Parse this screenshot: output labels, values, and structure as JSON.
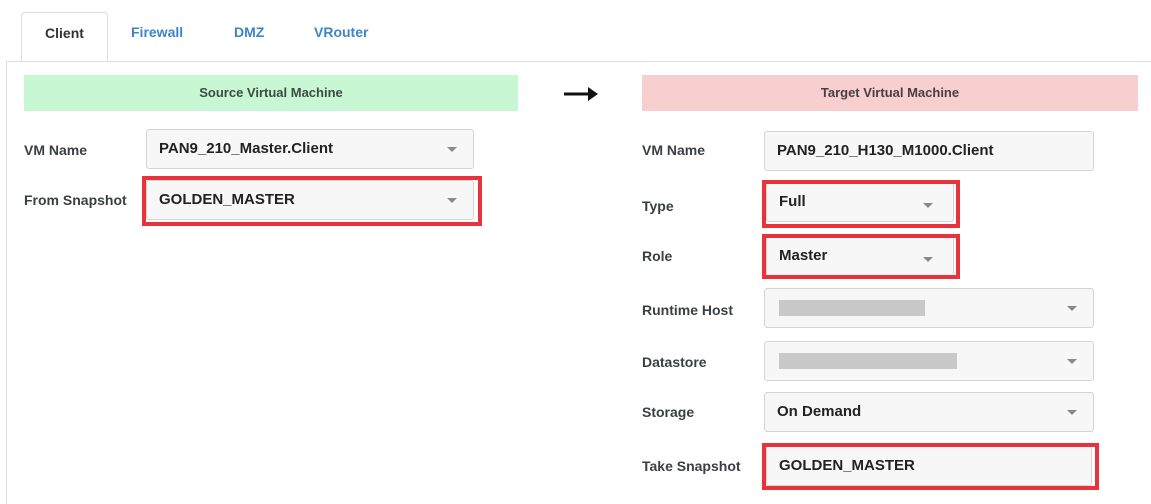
{
  "tabs": [
    {
      "label": "Client",
      "active": true
    },
    {
      "label": "Firewall",
      "active": false
    },
    {
      "label": "DMZ",
      "active": false
    },
    {
      "label": "VRouter",
      "active": false
    }
  ],
  "source": {
    "title": "Source Virtual Machine",
    "vm_name_label": "VM Name",
    "vm_name_value": "PAN9_210_Master.Client",
    "snapshot_label": "From Snapshot",
    "snapshot_value": "GOLDEN_MASTER"
  },
  "target": {
    "title": "Target Virtual Machine",
    "vm_name_label": "VM Name",
    "vm_name_value": "PAN9_210_H130_M1000.Client",
    "type_label": "Type",
    "type_value": "Full",
    "role_label": "Role",
    "role_value": "Master",
    "runtime_host_label": "Runtime Host",
    "runtime_host_value": "",
    "datastore_label": "Datastore",
    "datastore_value": "",
    "storage_label": "Storage",
    "storage_value": "On Demand",
    "take_snapshot_label": "Take Snapshot",
    "take_snapshot_value": "GOLDEN_MASTER"
  },
  "colors": {
    "source_header_bg": "#c8f7d4",
    "target_header_bg": "#f8cfcf",
    "highlight": "#e8323c",
    "tab_link": "#3e85c6"
  },
  "icons": {
    "arrow": "arrow-right-icon",
    "dropdown": "chevron-down-icon"
  }
}
